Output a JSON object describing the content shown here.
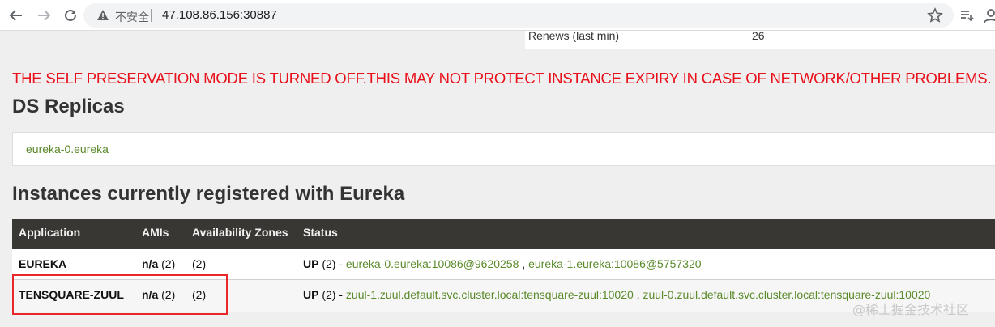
{
  "browser": {
    "security_label": "不安全",
    "url": "47.108.86.156:30887"
  },
  "stats": {
    "label": "Renews (last min)",
    "value": "26"
  },
  "warning_text": "THE SELF PRESERVATION MODE IS TURNED OFF.THIS MAY NOT PROTECT INSTANCE EXPIRY IN CASE OF NETWORK/OTHER PROBLEMS.",
  "ds": {
    "title": "DS Replicas",
    "replica": "eureka-0.eureka"
  },
  "instances": {
    "title": "Instances currently registered with Eureka",
    "headers": [
      "Application",
      "AMIs",
      "Availability Zones",
      "Status"
    ],
    "rows": [
      {
        "application": "EUREKA",
        "amis_bold": "n/a",
        "amis_count": "(2)",
        "zones": "(2)",
        "status_bold": "UP",
        "status_rest": "(2) -",
        "links": [
          "eureka-0.eureka:10086@9620258",
          "eureka-1.eureka:10086@5757320"
        ],
        "link_sep": ","
      },
      {
        "application": "TENSQUARE-ZUUL",
        "amis_bold": "n/a",
        "amis_count": "(2)",
        "zones": "(2)",
        "status_bold": "UP",
        "status_rest": "(2) -",
        "links": [
          "zuul-1.zuul.default.svc.cluster.local:tensquare-zuul:10020",
          "zuul-0.zuul.default.svc.cluster.local:tensquare-zuul:10020"
        ],
        "link_sep": ","
      }
    ]
  },
  "watermark": "@稀土掘金技术社区",
  "colors": {
    "warning": "#e8101a",
    "link": "#5a8a2a",
    "table_header": "#383733",
    "highlight": "#e8262b"
  }
}
